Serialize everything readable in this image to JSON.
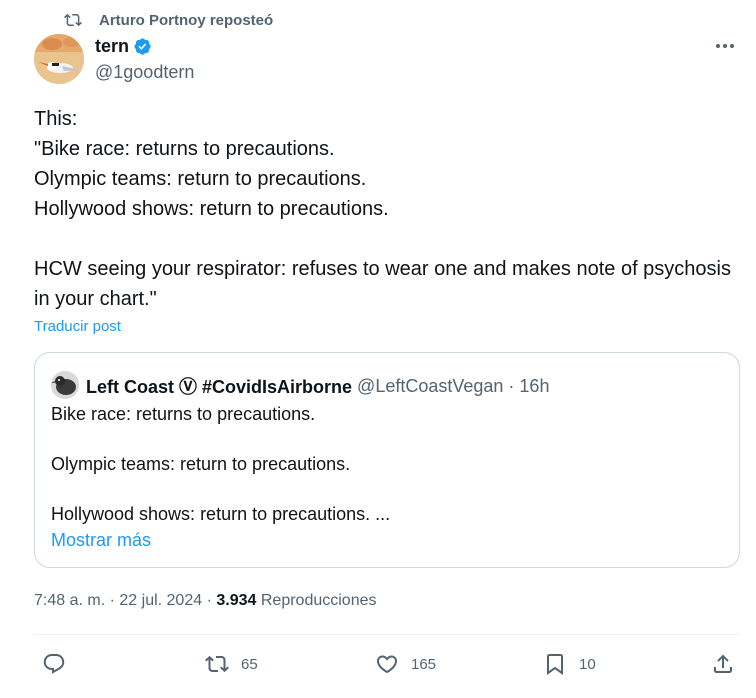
{
  "repost": {
    "text": "Arturo Portnoy reposteó"
  },
  "author": {
    "name": "tern",
    "handle": "@1goodtern"
  },
  "tweet": {
    "text": "This:\n\"Bike race: returns to precautions.\nOlympic teams: return to precautions.\nHollywood shows: return to precautions.\n\nHCW seeing your respirator: refuses to wear one and makes note of psychosis in your chart.\"",
    "translate": "Traducir post"
  },
  "quote": {
    "name": "Left Coast Ⓥ #CovidIsAirborne",
    "handle": "@LeftCoastVegan",
    "dot": "·",
    "time": "16h",
    "text": "Bike race: returns to precautions.\n\nOlympic teams: return to precautions.\n\nHollywood shows: return to precautions. ...",
    "show_more": "Mostrar más"
  },
  "meta": {
    "time": "7:48 a. m.",
    "sep": "·",
    "date": "22 jul. 2024",
    "views": "3.934",
    "views_label": "Reproducciones"
  },
  "actions": {
    "reply_icon": "reply-icon",
    "repost_count": "65",
    "like_count": "165",
    "bookmark_count": "10"
  },
  "colors": {
    "link": "#1d9bf0",
    "muted": "#536471",
    "text": "#0f1419"
  }
}
